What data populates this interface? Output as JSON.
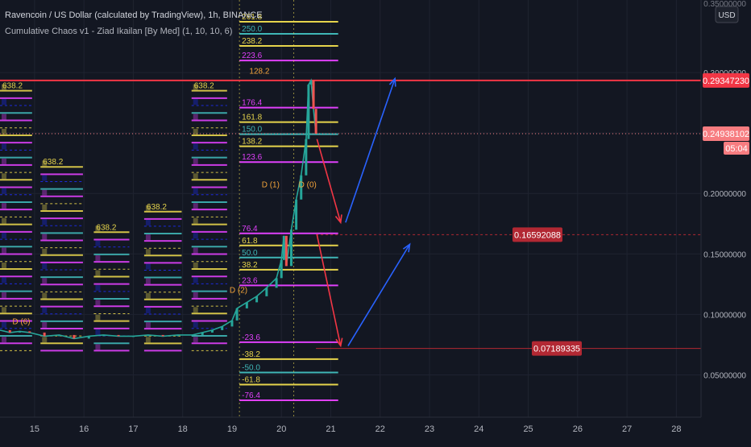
{
  "header": {
    "title": "Ravencoin / US Dollar (calculated by TradingView), 1h, BINANCE",
    "indicator": "Cumulative Chaos v1 - Ziad Ikailan [By Med] (1, 10, 10, 6)"
  },
  "price_axis": {
    "currency": "USD",
    "top_tick": "0.35000000",
    "ticks": [
      {
        "value": 0.3,
        "label": "0.30000000"
      },
      {
        "value": 0.25,
        "label": "0.25000000"
      },
      {
        "value": 0.2,
        "label": "0.20000000"
      },
      {
        "value": 0.15,
        "label": "0.15000000"
      },
      {
        "value": 0.1,
        "label": "0.10000000"
      },
      {
        "value": 0.05,
        "label": "0.05000000"
      }
    ]
  },
  "time_axis": [
    "15",
    "16",
    "17",
    "18",
    "19",
    "20",
    "21",
    "22",
    "23",
    "24",
    "25",
    "26",
    "27",
    "28"
  ],
  "badges": {
    "high": {
      "label": "0.29347230",
      "value": 0.2935,
      "color": "#f23645"
    },
    "last": {
      "label": "0.24938102",
      "value": 0.2494,
      "color": "#f77c80"
    },
    "countdown": "05:04",
    "target1": {
      "label": "0.16592088",
      "value": 0.1659,
      "color": "#b22833"
    },
    "target2": {
      "label": "0.07189335",
      "value": 0.0719,
      "color": "#b22833"
    }
  },
  "chart_data": {
    "type": "line",
    "title": "Ravencoin / US Dollar (calculated by TradingView), 1h, BINANCE",
    "xlabel": "",
    "ylabel": "",
    "ylim": [
      0.015,
      0.36
    ],
    "x_range": [
      14.3,
      28.5
    ],
    "price_path": [
      [
        14.3,
        0.087
      ],
      [
        14.5,
        0.085
      ],
      [
        14.7,
        0.086
      ],
      [
        14.9,
        0.085
      ],
      [
        15.2,
        0.082
      ],
      [
        15.5,
        0.083
      ],
      [
        15.8,
        0.08
      ],
      [
        16.1,
        0.082
      ],
      [
        16.4,
        0.083
      ],
      [
        16.7,
        0.082
      ],
      [
        17.0,
        0.082
      ],
      [
        17.3,
        0.083
      ],
      [
        17.6,
        0.082
      ],
      [
        17.9,
        0.083
      ],
      [
        18.2,
        0.083
      ],
      [
        18.4,
        0.085
      ],
      [
        18.6,
        0.087
      ],
      [
        18.8,
        0.09
      ],
      [
        19.0,
        0.095
      ],
      [
        19.1,
        0.105
      ],
      [
        19.3,
        0.11
      ],
      [
        19.5,
        0.115
      ],
      [
        19.7,
        0.122
      ],
      [
        19.9,
        0.13
      ],
      [
        20.0,
        0.145
      ],
      [
        20.05,
        0.165
      ],
      [
        20.1,
        0.14
      ],
      [
        20.2,
        0.17
      ],
      [
        20.3,
        0.195
      ],
      [
        20.4,
        0.215
      ],
      [
        20.5,
        0.245
      ],
      [
        20.55,
        0.29
      ],
      [
        20.6,
        0.2935
      ],
      [
        20.65,
        0.27
      ],
      [
        20.7,
        0.2494
      ]
    ],
    "fib_levels": [
      {
        "label": "261.8",
        "value": 0.342
      },
      {
        "label": "250.0",
        "value": 0.332
      },
      {
        "label": "238.2",
        "value": 0.322
      },
      {
        "label": "223.6",
        "value": 0.31
      },
      {
        "label": "176.4",
        "value": 0.271
      },
      {
        "label": "161.8",
        "value": 0.259
      },
      {
        "label": "150.0",
        "value": 0.249
      },
      {
        "label": "138.2",
        "value": 0.239
      },
      {
        "label": "123.6",
        "value": 0.226
      },
      {
        "label": "76.4",
        "value": 0.167
      },
      {
        "label": "61.8",
        "value": 0.157
      },
      {
        "label": "50.0",
        "value": 0.147
      },
      {
        "label": "38.2",
        "value": 0.137
      },
      {
        "label": "23.6",
        "value": 0.124
      },
      {
        "label": "-23.6",
        "value": 0.077
      },
      {
        "label": "-38.2",
        "value": 0.063
      },
      {
        "label": "-50.0",
        "value": 0.052
      },
      {
        "label": "-61.8",
        "value": 0.042
      },
      {
        "label": "-76.4",
        "value": 0.029
      }
    ],
    "historic_fib_blocks": [
      {
        "x0": 14.3,
        "x1": 14.95,
        "top_label": "638.2",
        "top": 0.285,
        "bottom": 0.07
      },
      {
        "x0": 15.12,
        "x1": 15.98,
        "top_label": "638.2",
        "top": 0.222,
        "bottom": 0.07
      },
      {
        "x0": 16.2,
        "x1": 16.92,
        "top_label": "638.2",
        "top": 0.168,
        "bottom": 0.07
      },
      {
        "x0": 17.22,
        "x1": 17.98,
        "top_label": "638.2",
        "top": 0.185,
        "bottom": 0.07
      },
      {
        "x0": 18.18,
        "x1": 18.9,
        "top_label": "638.2",
        "top": 0.285,
        "bottom": 0.07
      }
    ],
    "annotations": [
      {
        "text": "D (1)",
        "x": 19.6,
        "y": 0.205
      },
      {
        "text": "D (0)",
        "x": 20.35,
        "y": 0.205
      },
      {
        "text": "D (2)",
        "x": 18.95,
        "y": 0.118
      },
      {
        "text": "D (6)",
        "x": 14.55,
        "y": 0.092
      },
      {
        "text": "128.2",
        "x": 19.35,
        "y": 0.299
      }
    ],
    "projections": [
      {
        "color": "#f23645",
        "points": [
          [
            20.72,
            0.245
          ],
          [
            21.2,
            0.176
          ]
        ]
      },
      {
        "color": "#f23645",
        "points": [
          [
            20.72,
            0.166
          ],
          [
            21.2,
            0.074
          ]
        ]
      },
      {
        "color": "#2962ff",
        "points": [
          [
            21.3,
            0.176
          ],
          [
            22.3,
            0.295
          ]
        ]
      },
      {
        "color": "#2962ff",
        "points": [
          [
            21.35,
            0.074
          ],
          [
            22.6,
            0.158
          ]
        ]
      }
    ],
    "colors": {
      "background": "#131722",
      "fib_yellow": "#e6d44c",
      "fib_cyan": "#3fb6b6",
      "fib_magenta": "#e040fb",
      "fib_blue": "#1e2cf0",
      "candle_up": "#26a69a",
      "candle_down": "#ef5350",
      "annotation": "#f2a33a"
    },
    "grid": true,
    "legend": "none"
  }
}
